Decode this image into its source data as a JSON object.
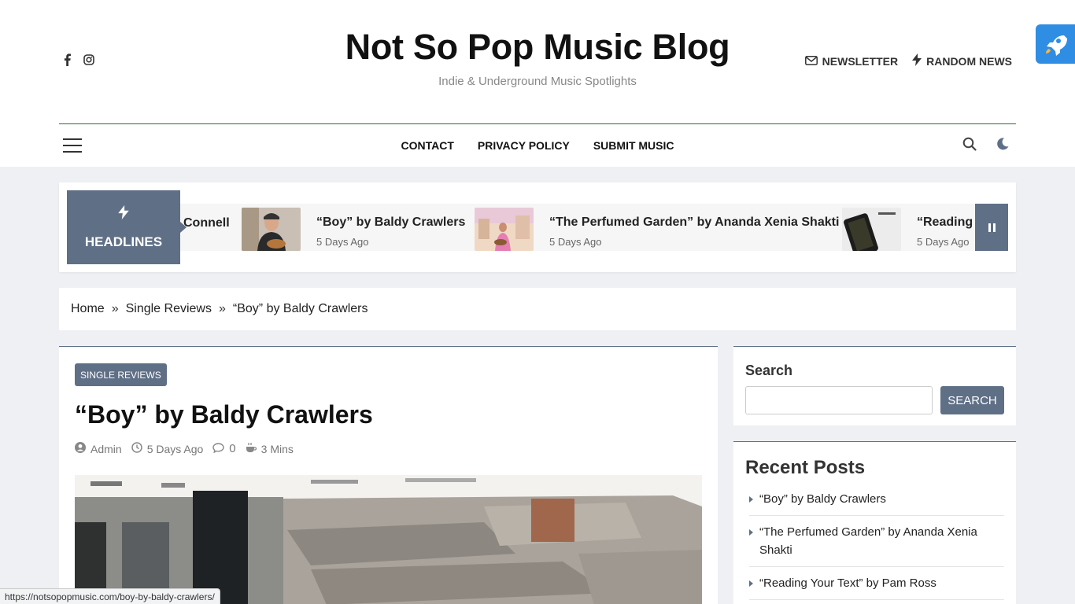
{
  "header": {
    "site_title": "Not So Pop Music Blog",
    "tagline": "Indie & Underground Music Spotlights",
    "social_icons": [
      "facebook-icon",
      "instagram-icon"
    ],
    "links": [
      {
        "label": "NEWSLETTER",
        "icon": "envelope-icon"
      },
      {
        "label": "RANDOM NEWS",
        "icon": "bolt-icon"
      }
    ],
    "accent_color": "#2e6e3a"
  },
  "nav": {
    "menu": [
      "CONTACT",
      "PRIVACY POLICY",
      "SUBMIT MUSIC"
    ],
    "icons": [
      "hamburger-icon",
      "search-icon",
      "moon-icon"
    ]
  },
  "ticker": {
    "label": "HEADLINES",
    "partial_title": "Connell",
    "items": [
      {
        "title": "“Boy” by Baldy Crawlers",
        "date": "5 Days Ago"
      },
      {
        "title": "“The Perfumed Garden” by Ananda Xenia Shakti",
        "date": "5 Days Ago"
      },
      {
        "title": "“Reading Y",
        "date": "5 Days Ago"
      }
    ],
    "theme_color": "#5f6f86"
  },
  "breadcrumb": [
    "Home",
    "Single Reviews",
    "“Boy” by Baldy Crawlers"
  ],
  "article": {
    "category": "SINGLE REVIEWS",
    "title": "“Boy” by Baldy Crawlers",
    "author": "Admin",
    "date": "5 Days Ago",
    "comments": "0",
    "read_time": "3 Mins"
  },
  "sidebar": {
    "search_title": "Search",
    "search_button": "SEARCH",
    "search_value": "",
    "recent_title": "Recent Posts",
    "recent_posts": [
      "“Boy” by Baldy Crawlers",
      "“The Perfumed Garden” by Ananda Xenia Shakti",
      "“Reading Your Text” by Pam Ross"
    ]
  },
  "status_url": "https://notsopopmusic.com/boy-by-baldy-crawlers/"
}
